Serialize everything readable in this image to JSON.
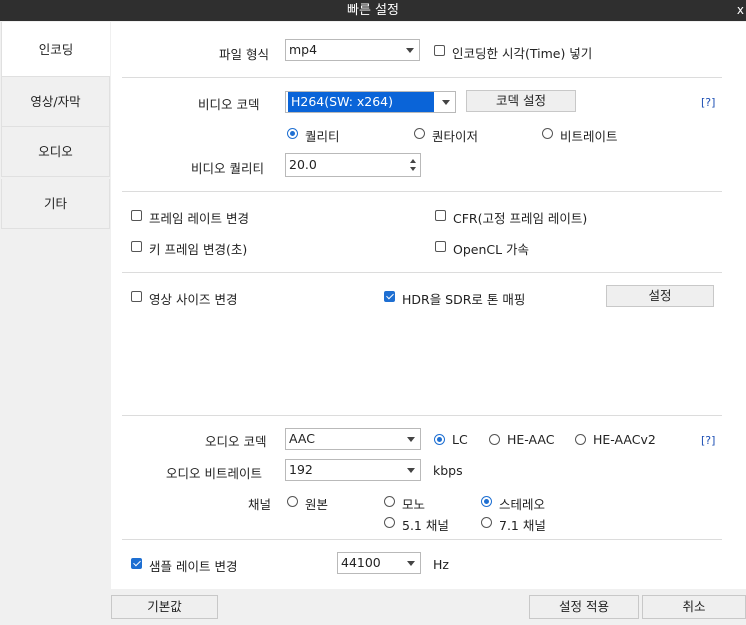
{
  "window": {
    "title": "빠른 설정",
    "close_glyph": "x"
  },
  "tabs": [
    {
      "label": "인코딩",
      "active": true
    },
    {
      "label": "영상/자막",
      "active": false
    },
    {
      "label": "오디오",
      "active": false
    },
    {
      "label": "기타",
      "active": false
    }
  ],
  "file": {
    "format_label": "파일 형식",
    "format_value": "mp4",
    "time_insert_label": "인코딩한 시각(Time) 넣기",
    "time_insert_checked": false
  },
  "video": {
    "codec_label": "비디오 코덱",
    "codec_value": "H264(SW: x264)",
    "codec_settings_button": "코덱 설정",
    "help": "[?]",
    "mode_options": [
      "퀄리티",
      "퀀타이저",
      "비트레이트"
    ],
    "mode_selected": "퀄리티",
    "quality_label": "비디오 퀄리티",
    "quality_value": "20.0"
  },
  "options": {
    "frame_rate_change": {
      "label": "프레임 레이트 변경",
      "checked": false
    },
    "cfr": {
      "label": "CFR(고정 프레임 레이트)",
      "checked": false
    },
    "keyframe_change": {
      "label": "키 프레임 변경(초)",
      "checked": false
    },
    "opencl": {
      "label": "OpenCL 가속",
      "checked": false
    },
    "resize": {
      "label": "영상 사이즈 변경",
      "checked": false
    },
    "hdr_to_sdr": {
      "label": "HDR을 SDR로 톤 매핑",
      "checked": true
    },
    "hdr_settings_button": "설정"
  },
  "audio": {
    "codec_label": "오디오 코덱",
    "codec_value": "AAC",
    "profile_options": [
      "LC",
      "HE-AAC",
      "HE-AACv2"
    ],
    "profile_selected": "LC",
    "help": "[?]",
    "bitrate_label": "오디오 비트레이트",
    "bitrate_value": "192",
    "bitrate_unit": "kbps",
    "channel_label": "채널",
    "channel_options": [
      "원본",
      "모노",
      "스테레오",
      "5.1 채널",
      "7.1 채널"
    ],
    "channel_selected": "스테레오",
    "sample_rate_change": {
      "label": "샘플 레이트 변경",
      "checked": true
    },
    "sample_rate_value": "44100",
    "sample_rate_unit": "Hz"
  },
  "footer": {
    "default_button": "기본값",
    "apply_button": "설정 적용",
    "cancel_button": "취소"
  },
  "colors": {
    "titlebar": "#2f2f2f",
    "accent": "#1e6fd2",
    "selection": "#0a64d8"
  }
}
